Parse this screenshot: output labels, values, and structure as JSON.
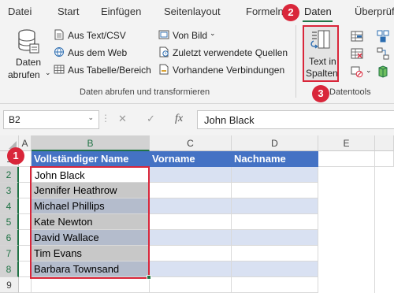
{
  "tabs": [
    "Datei",
    "Start",
    "Einfügen",
    "Seitenlayout",
    "Formeln",
    "Daten",
    "Überprüfen"
  ],
  "active_tab": "Daten",
  "ribbon": {
    "get_data_line1": "Daten",
    "get_data_line2": "abrufen",
    "from_text": "Aus Text/CSV",
    "from_web": "Aus dem Web",
    "from_table": "Aus Tabelle/Bereich",
    "from_image": "Von Bild",
    "recent_sources": "Zuletzt verwendete Quellen",
    "existing_connections": "Vorhandene Verbindungen",
    "group_get_transform": "Daten abrufen und transformieren",
    "text_to_columns_line1": "Text in",
    "text_to_columns_line2": "Spalten",
    "group_data_tools": "Datentools"
  },
  "callouts": [
    "1",
    "2",
    "3"
  ],
  "name_box": "B2",
  "formula_value": "John Black",
  "fx_label": "fx",
  "columns": [
    "A",
    "B",
    "C",
    "D",
    "E"
  ],
  "rows": [
    "1",
    "2",
    "3",
    "4",
    "5",
    "6",
    "7",
    "8",
    "9"
  ],
  "table_headers": [
    "Vollständiger Name",
    "Vorname",
    "Nachname"
  ],
  "names": [
    "John Black",
    "Jennifer Heathrow",
    "Michael Phillips",
    "Kate Newton",
    "David Wallace",
    "Tim Evans",
    "Barbara Townsand"
  ],
  "colors": {
    "accent_green": "#217346",
    "header_blue": "#4472c4",
    "band_light": "#d9e1f2",
    "selection_gray": "#c8c8c8",
    "callout_red": "#d9263a"
  }
}
